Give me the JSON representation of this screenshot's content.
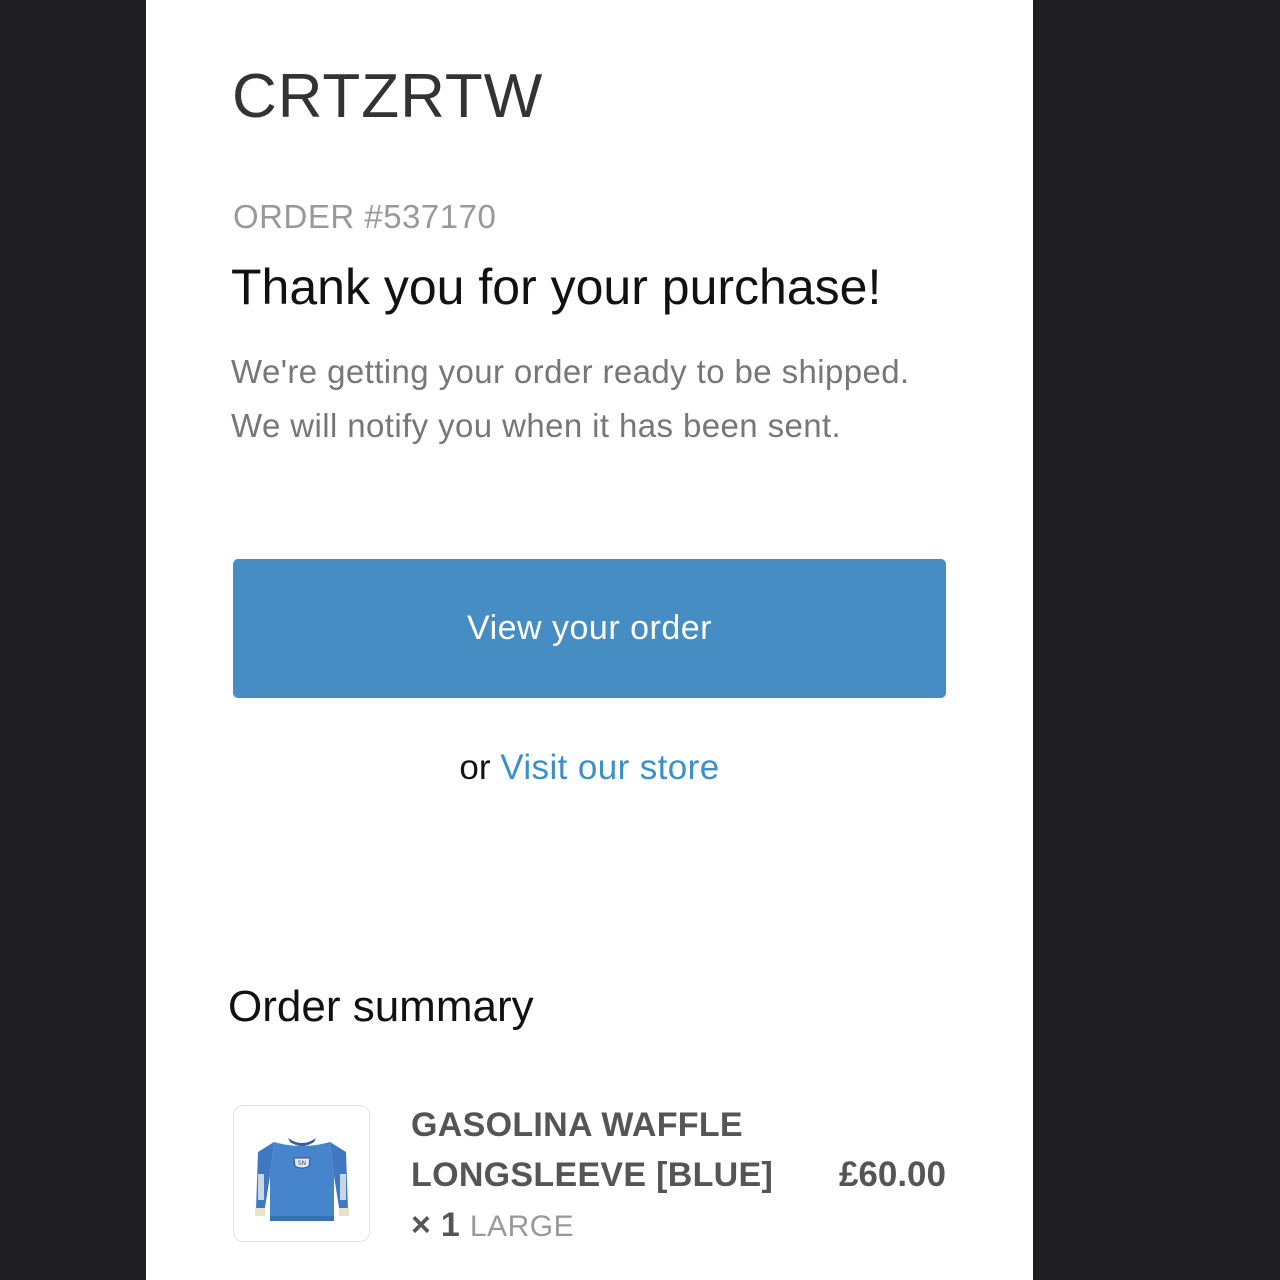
{
  "shop": {
    "name": "CRTZRTW"
  },
  "order": {
    "number_label": "ORDER #537170",
    "headline": "Thank you for your purchase!",
    "message": "We're getting your order ready to be shipped. We will notify you when it has been sent."
  },
  "actions": {
    "view_order_label": "View your order",
    "or_text": "or",
    "visit_store_label": "Visit our store",
    "button_color": "#468dc4",
    "link_color": "#3d8fc5"
  },
  "summary": {
    "title": "Order summary",
    "items": [
      {
        "title": "GASOLINA WAFFLE LONGSLEEVE [BLUE]",
        "quantity": "× 1",
        "variant": "LARGE",
        "price": "£60.00",
        "image_icon": "blue-longsleeve-shirt-icon"
      }
    ]
  }
}
